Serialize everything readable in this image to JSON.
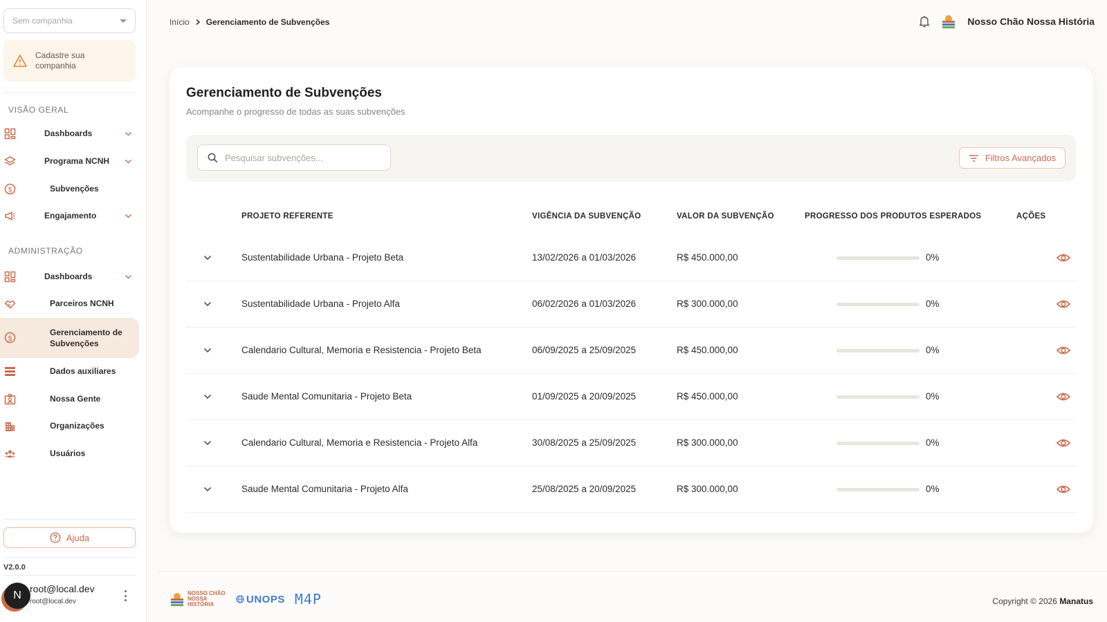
{
  "sidebar": {
    "company_placeholder": "Sem companhia",
    "alert_text": "Cadastre sua companhia",
    "section_overview": "VISÃO GERAL",
    "overview_items": [
      {
        "label": "Dashboards",
        "icon": "grid-icon",
        "has_chevron": true
      },
      {
        "label": "Programa NCNH",
        "icon": "layers-icon",
        "has_chevron": true
      },
      {
        "label": "Subvenções",
        "icon": "dollar-circle-icon",
        "has_chevron": false
      },
      {
        "label": "Engajamento",
        "icon": "megaphone-icon",
        "has_chevron": true
      }
    ],
    "section_admin": "ADMINISTRAÇÃO",
    "admin_items": [
      {
        "label": "Dashboards",
        "icon": "grid-icon",
        "has_chevron": true
      },
      {
        "label": "Parceiros NCNH",
        "icon": "handshake-icon",
        "has_chevron": false
      },
      {
        "label": "Gerenciamento de Subvenções",
        "icon": "dollar-circle-icon",
        "has_chevron": false,
        "active": true
      },
      {
        "label": "Dados auxiliares",
        "icon": "list-icon",
        "has_chevron": false
      },
      {
        "label": "Nossa Gente",
        "icon": "id-badge-icon",
        "has_chevron": false
      },
      {
        "label": "Organizações",
        "icon": "building-icon",
        "has_chevron": false
      },
      {
        "label": "Usuários",
        "icon": "users-icon",
        "has_chevron": false
      }
    ],
    "help_label": "Ajuda",
    "version": "V2.0.0",
    "user": {
      "initial": "N",
      "name": "root@local.dev",
      "email": "root@local.dev"
    }
  },
  "header": {
    "breadcrumb_home": "Início",
    "breadcrumb_current": "Gerenciamento de Subvenções",
    "org_name": "Nosso Chão Nossa História"
  },
  "main": {
    "title": "Gerenciamento de Subvenções",
    "subtitle": "Acompanhe o progresso de todas as suas subvenções",
    "search_placeholder": "Pesquisar subvenções...",
    "filters_label": "Filtros Avançados",
    "columns": {
      "project": "PROJETO REFERENTE",
      "validity": "VIGÊNCIA DA SUBVENÇÃO",
      "value": "VALOR DA SUBVENÇÃO",
      "progress": "PROGRESSO DOS PRODUTOS ESPERADOS",
      "actions": "AÇÕES"
    },
    "rows": [
      {
        "project": "Sustentabilidade Urbana - Projeto Beta",
        "validity": "13/02/2026 a 01/03/2026",
        "value": "R$ 450.000,00",
        "progress": 0,
        "progress_label": "0%"
      },
      {
        "project": "Sustentabilidade Urbana - Projeto Alfa",
        "validity": "06/02/2026 a 01/03/2026",
        "value": "R$ 300.000,00",
        "progress": 0,
        "progress_label": "0%"
      },
      {
        "project": "Calendario Cultural, Memoria e Resistencia - Projeto Beta",
        "validity": "06/09/2025 a 25/09/2025",
        "value": "R$ 450.000,00",
        "progress": 0,
        "progress_label": "0%"
      },
      {
        "project": "Saude Mental Comunitaria - Projeto Beta",
        "validity": "01/09/2025 a 20/09/2025",
        "value": "R$ 450.000,00",
        "progress": 0,
        "progress_label": "0%"
      },
      {
        "project": "Calendario Cultural, Memoria e Resistencia - Projeto Alfa",
        "validity": "30/08/2025 a 25/09/2025",
        "value": "R$ 300.000,00",
        "progress": 0,
        "progress_label": "0%"
      },
      {
        "project": "Saude Mental Comunitaria - Projeto Alfa",
        "validity": "25/08/2025 a 20/09/2025",
        "value": "R$ 300.000,00",
        "progress": 0,
        "progress_label": "0%"
      }
    ]
  },
  "footer": {
    "logo_nch": "NOSSO CHÃO NOSSA HISTÓRIA",
    "logo_unops": "UNOPS",
    "logo_m4p": "M4P",
    "copyright_prefix": "Copyright © 2026",
    "copyright_brand": "Manatus"
  },
  "colors": {
    "accent": "#c96b4a",
    "active_bg": "#f6e9dd",
    "alert_bg": "#fdf4ea",
    "progress_track": "#e8e5dc",
    "partner_blue": "#3f7cc4"
  }
}
